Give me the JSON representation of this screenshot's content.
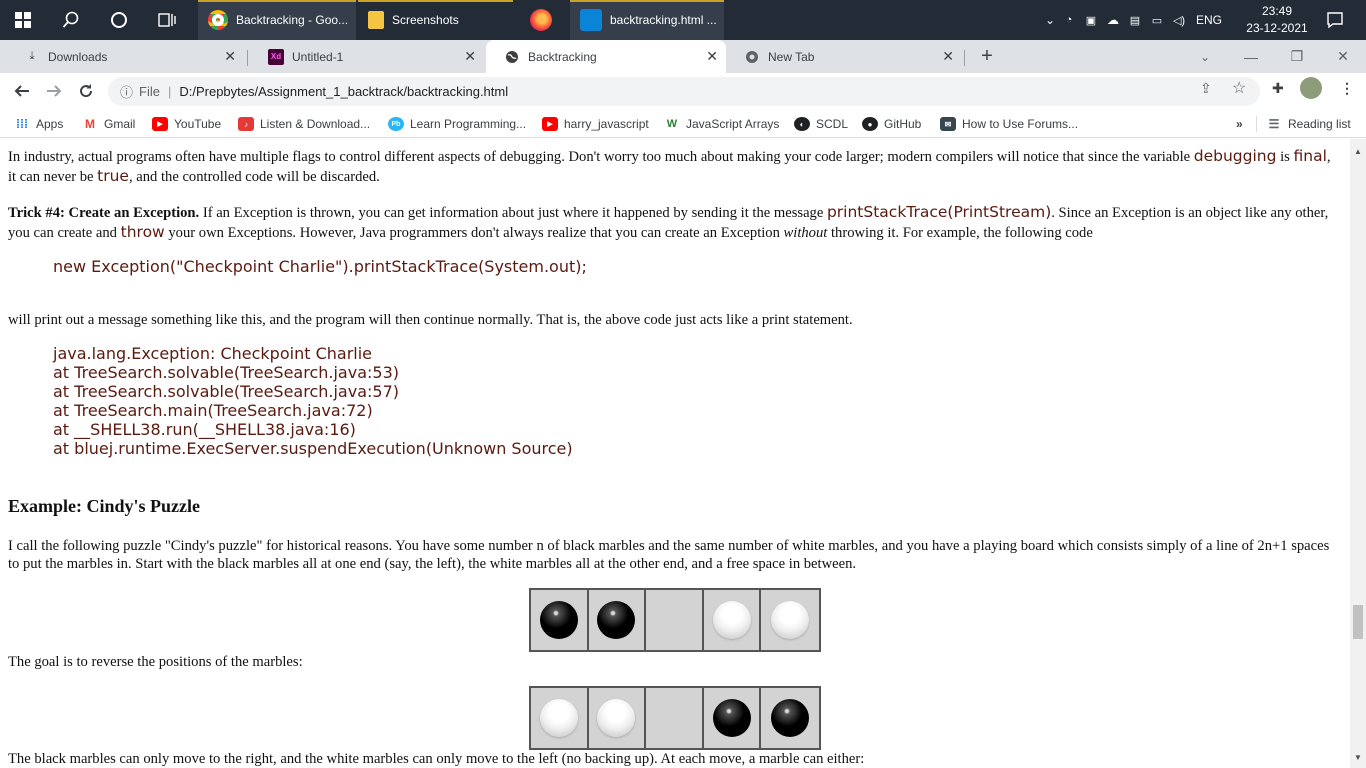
{
  "taskbar": {
    "apps": [
      {
        "label": "Backtracking - Goo..."
      },
      {
        "label": "Screenshots"
      },
      {
        "label": ""
      },
      {
        "label": "backtracking.html ..."
      }
    ],
    "tray": {
      "lang": "ENG",
      "time": "23:49",
      "date": "23-12-2021"
    }
  },
  "tabs": [
    {
      "label": "Downloads",
      "icon": "download-icon"
    },
    {
      "label": "Untitled-1",
      "icon": "xd-icon"
    },
    {
      "label": "Backtracking",
      "icon": "globe-icon"
    },
    {
      "label": "New Tab",
      "icon": "chrome-icon"
    }
  ],
  "address": {
    "scheme": "File",
    "url": "D:/Prepbytes/Assignment_1_backtrack/backtracking.html"
  },
  "bookmarks": [
    {
      "label": "Apps",
      "color": "#1a73e8",
      "icon": "apps-icon"
    },
    {
      "label": "Gmail",
      "color": "#ea4335",
      "icon": "gmail-icon"
    },
    {
      "label": "YouTube",
      "color": "#ff0000",
      "icon": "youtube-icon"
    },
    {
      "label": "Listen & Download...",
      "color": "#e53935",
      "icon": "music-icon"
    },
    {
      "label": "Learn Programming...",
      "color": "#29b6f6",
      "icon": "pb-icon"
    },
    {
      "label": "harry_javascript",
      "color": "#ff0000",
      "icon": "youtube-icon"
    },
    {
      "label": "JavaScript Arrays",
      "color": "#2e7d32",
      "icon": "w3-icon"
    },
    {
      "label": "SCDL",
      "color": "#202124",
      "icon": "globe-icon"
    },
    {
      "label": "GitHub",
      "color": "#202124",
      "icon": "github-icon"
    },
    {
      "label": "How to Use Forums...",
      "color": "#37474f",
      "icon": "forum-icon"
    }
  ],
  "reading_list": "Reading list",
  "content": {
    "p1a": "In industry, actual programs often have multiple flags to control different aspects of debugging. Don't worry too much about making your code larger; modern compilers will notice that since the variable",
    "p1_code1": "debugging",
    "p1b": " is ",
    "p1_code2": "final",
    "p1c": ", it can never be ",
    "p1_code3": "true",
    "p1d": ", and the controlled code will be discarded.",
    "trick_title": "Trick #4: Create an Exception.",
    "trick_a": " If an Exception is thrown, you can get information about just where it happened by sending it the message ",
    "trick_code1": "printStackTrace(PrintStream)",
    "trick_b": ". Since an Exception is an object like any other, you can create and ",
    "trick_code2": "throw",
    "trick_c": " your own Exceptions. However, Java programmers don't always realize that you can create an Exception ",
    "trick_em": "without",
    "trick_d": " throwing it. For example, the following code",
    "code_line": "new Exception(\"Checkpoint Charlie\").printStackTrace(System.out);",
    "p3": "will print out a message something like this, and the program will then continue normally. That is, the above code just acts like a print statement.",
    "trace": [
      "java.lang.Exception: Checkpoint Charlie",
      "at TreeSearch.solvable(TreeSearch.java:53)",
      "at TreeSearch.solvable(TreeSearch.java:57)",
      "at TreeSearch.main(TreeSearch.java:72)",
      "at __SHELL38.run(__SHELL38.java:16)",
      "at bluej.runtime.ExecServer.suspendExecution(Unknown Source)"
    ],
    "heading": "Example: Cindy's Puzzle",
    "p4": "I call the following puzzle \"Cindy's puzzle\" for historical reasons. You have some number n of black marbles and the same number of white marbles, and you have a playing board which consists simply of a line of 2n+1 spaces to put the marbles in. Start with the black marbles all at one end (say, the left), the white marbles all at the other end, and a free space in between.",
    "p5": "The goal is to reverse the positions of the marbles:",
    "p6": "The black marbles can only move to the right, and the white marbles can only move to the left (no backing up). At each move, a marble can either:",
    "board_start": [
      "black",
      "black",
      "empty",
      "white",
      "white"
    ],
    "board_goal": [
      "white",
      "white",
      "empty",
      "black",
      "black"
    ]
  }
}
